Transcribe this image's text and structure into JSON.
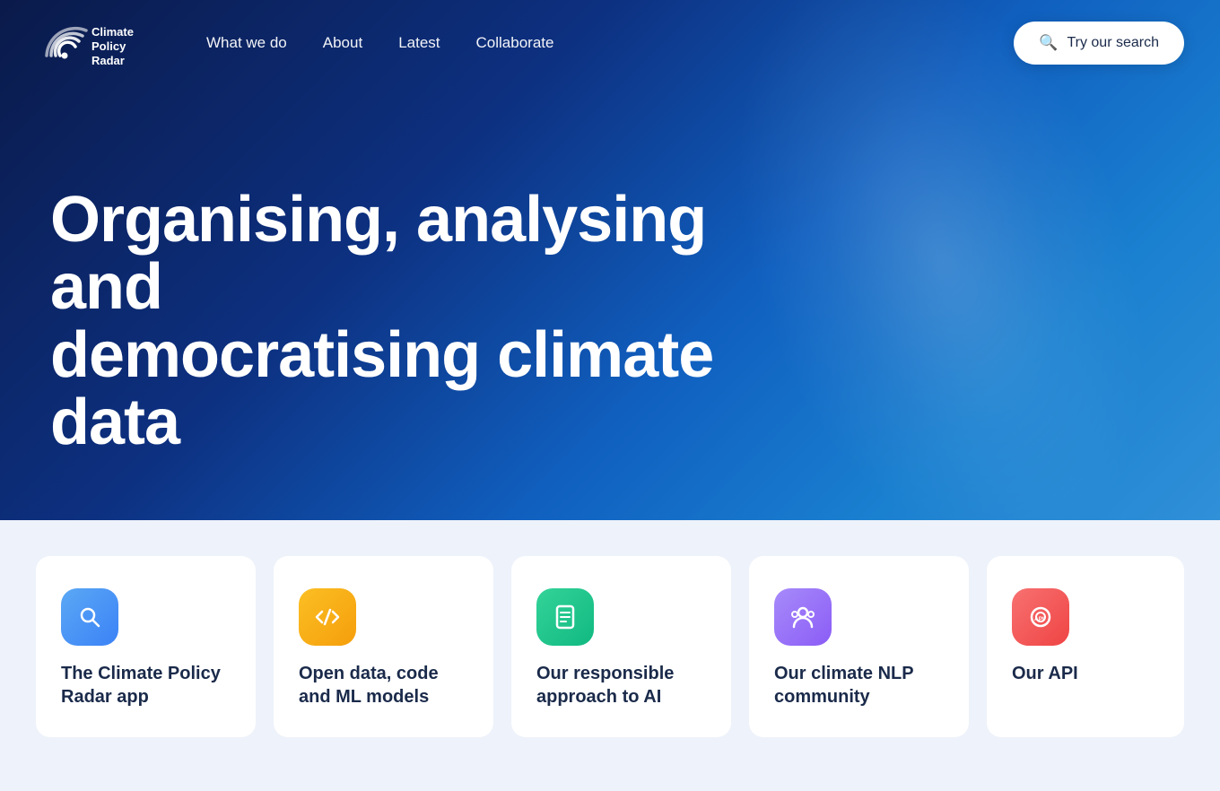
{
  "nav": {
    "logo_alt": "Climate Policy Radar",
    "links": [
      {
        "label": "What we do",
        "href": "#"
      },
      {
        "label": "About",
        "href": "#"
      },
      {
        "label": "Latest",
        "href": "#"
      },
      {
        "label": "Collaborate",
        "href": "#"
      }
    ],
    "search_btn": "Try our search"
  },
  "hero": {
    "title_line1": "Organising, analysing and",
    "title_line2": "democratising climate data"
  },
  "cards": [
    {
      "id": "climate-policy-radar-app",
      "icon_type": "blue",
      "icon_symbol": "🔍",
      "title": "The Climate Policy Radar app"
    },
    {
      "id": "open-data-code-ml",
      "icon_type": "yellow",
      "icon_symbol": "⟨/⟩",
      "title": "Open data, code and ML models"
    },
    {
      "id": "responsible-ai",
      "icon_type": "teal",
      "icon_symbol": "📋",
      "title": "Our responsible approach to AI"
    },
    {
      "id": "climate-nlp-community",
      "icon_type": "purple",
      "icon_symbol": "👥",
      "title": "Our climate NLP community"
    },
    {
      "id": "our-api",
      "icon_type": "red",
      "icon_symbol": "⚙",
      "title": "Our API"
    }
  ]
}
